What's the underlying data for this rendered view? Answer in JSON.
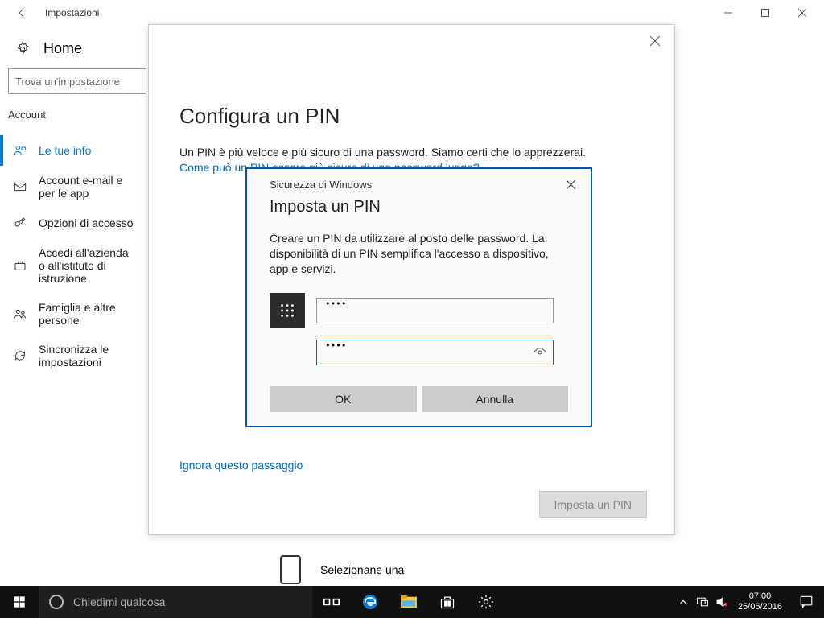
{
  "titlebar": {
    "title": "Impostazioni"
  },
  "home": {
    "label": "Home"
  },
  "search": {
    "placeholder": "Trova un'impostazione"
  },
  "category": "Account",
  "nav": {
    "items": [
      {
        "label": "Le tue info"
      },
      {
        "label": "Account e-mail e per le app"
      },
      {
        "label": "Opzioni di accesso"
      },
      {
        "label": "Accedi all'azienda o all'istituto di istruzione"
      },
      {
        "label": "Famiglia e altre persone"
      },
      {
        "label": "Sincronizza le impostazioni"
      }
    ]
  },
  "overlay": {
    "title": "Configura un PIN",
    "desc": "Un PIN è più veloce e più sicuro di una password. Siamo certi che lo apprezzerai.",
    "link": "Come può un PIN essere più sicuro di una password lunga?",
    "skip": "Ignora questo passaggio",
    "button": "Imposta un PIN"
  },
  "security": {
    "header": "Sicurezza di Windows",
    "title": "Imposta un PIN",
    "desc": "Creare un PIN da utilizzare al posto delle password. La disponibilità di un PIN semplifica l'accesso a dispositivo, app e servizi.",
    "pin1": "••••",
    "pin2": "••••",
    "ok": "OK",
    "cancel": "Annulla"
  },
  "seleziona": "Selezionane una",
  "taskbar": {
    "cortana": "Chiedimi qualcosa",
    "time": "07:00",
    "date": "25/06/2016"
  }
}
